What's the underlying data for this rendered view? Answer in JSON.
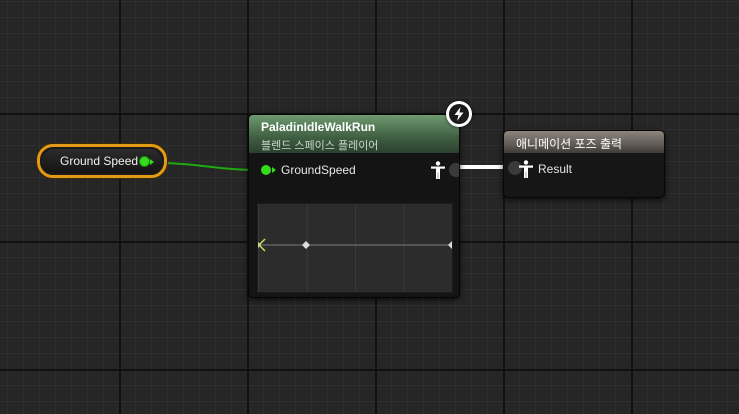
{
  "variable_node": {
    "label": "Ground Speed"
  },
  "blend_space_node": {
    "title": "PaladinIdleWalkRun",
    "subtitle": "블렌드 스페이스 플레이어",
    "input_pin": "GroundSpeed"
  },
  "output_node": {
    "title": "애니메이션 포즈 출력",
    "result_pin": "Result"
  },
  "icons": {
    "event": "lightning-bolt-icon",
    "pose": "pose-figure-icon"
  },
  "colors": {
    "float_wire": "#33dd1c",
    "pose_wire": "#ffffff",
    "variable_outline": "#e39a17",
    "blend_header": "#4e7350",
    "output_header": "#6e6963"
  }
}
